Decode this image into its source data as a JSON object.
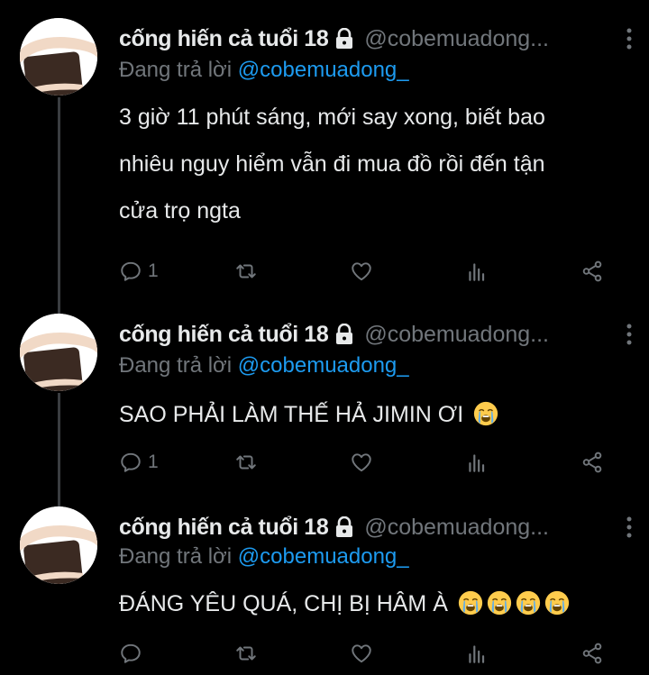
{
  "tweets": [
    {
      "display_name": "cống hiến cả tuổi 18",
      "handle": "@cobemuadong...",
      "reply_prefix": "Đang trả lời ",
      "reply_to": "@cobemuadong_",
      "text_lines": [
        "3 giờ 11 phút sáng, mới say xong, biết bao",
        "nhiêu nguy hiểm vẫn đi mua đồ rồi đến tận",
        "cửa trọ ngta"
      ],
      "emoji_count": 0,
      "reply_count": "1"
    },
    {
      "display_name": "cống hiến cả tuổi 18",
      "handle": "@cobemuadong...",
      "reply_prefix": "Đang trả lời ",
      "reply_to": "@cobemuadong_",
      "text_lines": [
        "SAO PHẢI LÀM THẾ HẢ JIMIN ƠI"
      ],
      "emoji_count": 1,
      "reply_count": "1"
    },
    {
      "display_name": "cống hiến cả tuổi 18",
      "handle": "@cobemuadong...",
      "reply_prefix": "Đang trả lời ",
      "reply_to": "@cobemuadong_",
      "text_lines": [
        "ĐÁNG YÊU QUÁ, CHỊ BỊ HÂM À"
      ],
      "emoji_count": 4,
      "reply_count": ""
    }
  ],
  "emoji_name": "loudly-crying-face",
  "colors": {
    "background": "#000000",
    "text": "#e7e9ea",
    "muted": "#71767b",
    "link": "#1d9bf0"
  }
}
